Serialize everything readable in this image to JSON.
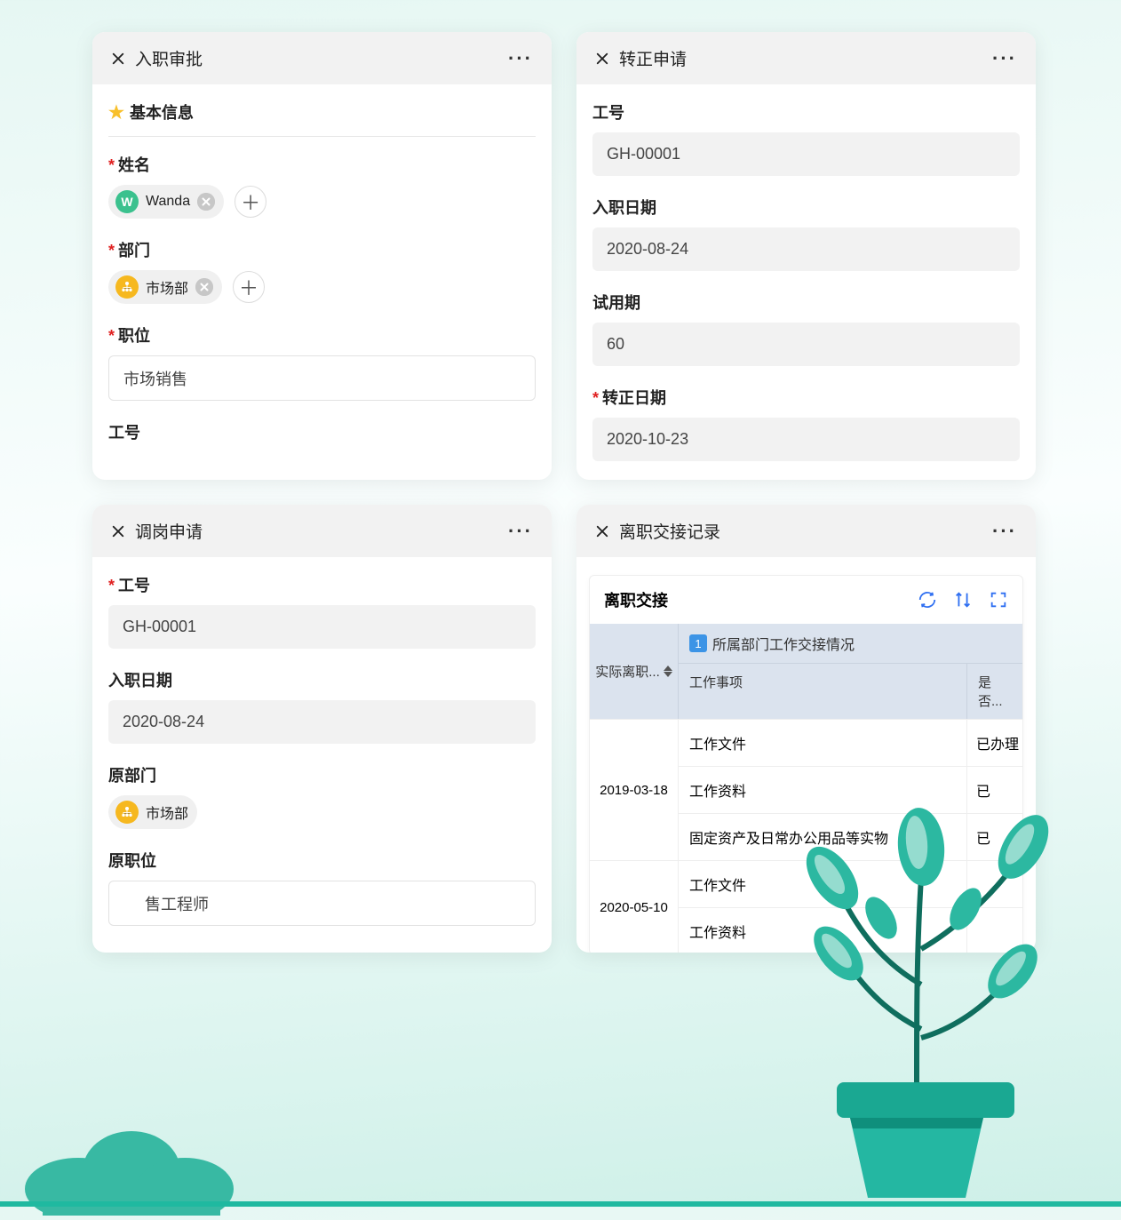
{
  "cards": {
    "onboarding": {
      "title": "入职审批",
      "section_label": "基本信息",
      "fields": {
        "name_label": "姓名",
        "name_value": "Wanda",
        "name_initial": "W",
        "dept_label": "部门",
        "dept_value": "市场部",
        "position_label": "职位",
        "position_value": "市场销售",
        "empno_label": "工号"
      }
    },
    "regularization": {
      "title": "转正申请",
      "fields": {
        "empno_label": "工号",
        "empno_value": "GH-00001",
        "hiredate_label": "入职日期",
        "hiredate_value": "2020-08-24",
        "probation_label": "试用期",
        "probation_value": "60",
        "regdate_label": "转正日期",
        "regdate_value": "2020-10-23"
      }
    },
    "transfer": {
      "title": "调岗申请",
      "fields": {
        "empno_label": "工号",
        "empno_value": "GH-00001",
        "hiredate_label": "入职日期",
        "hiredate_value": "2020-08-24",
        "origdept_label": "原部门",
        "origdept_value": "市场部",
        "origpos_label": "原职位",
        "origpos_value": "售工程师"
      }
    },
    "offboarding": {
      "title": "离职交接记录",
      "table": {
        "title": "离职交接",
        "col_date": "实际离职...",
        "col_group_num": "1",
        "col_group": "所属部门工作交接情况",
        "col_item": "工作事项",
        "col_status": "是否...",
        "rows": [
          {
            "date": "2019-03-18",
            "items": [
              {
                "item": "工作文件",
                "status": "已办理"
              },
              {
                "item": "工作资料",
                "status": "已"
              },
              {
                "item": "固定资产及日常办公用品等实物",
                "status": "已"
              }
            ]
          },
          {
            "date": "2020-05-10",
            "items": [
              {
                "item": "工作文件",
                "status": ""
              },
              {
                "item": "工作资料",
                "status": ""
              }
            ]
          }
        ]
      }
    }
  }
}
